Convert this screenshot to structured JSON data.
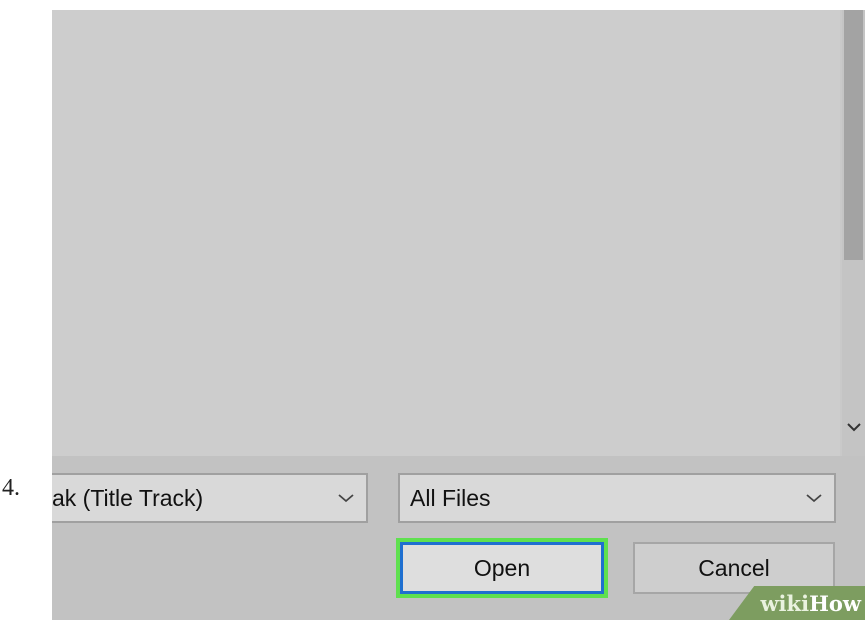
{
  "step_number": "4.",
  "dialog": {
    "file_name_value": "ak (Title Track)",
    "file_type_value": "All Files",
    "open_label": "Open",
    "cancel_label": "Cancel"
  },
  "icons": {
    "scroll_down": "chevron-down-icon",
    "file_name_dropdown": "chevron-down-icon",
    "file_type_dropdown": "chevron-down-icon"
  },
  "colors": {
    "open_highlight": "#5fe04f",
    "open_focus_border": "#1f6fd0",
    "watermark_bg": "#7d9d60"
  },
  "watermark": {
    "part1": "wiki",
    "part2": "How"
  }
}
